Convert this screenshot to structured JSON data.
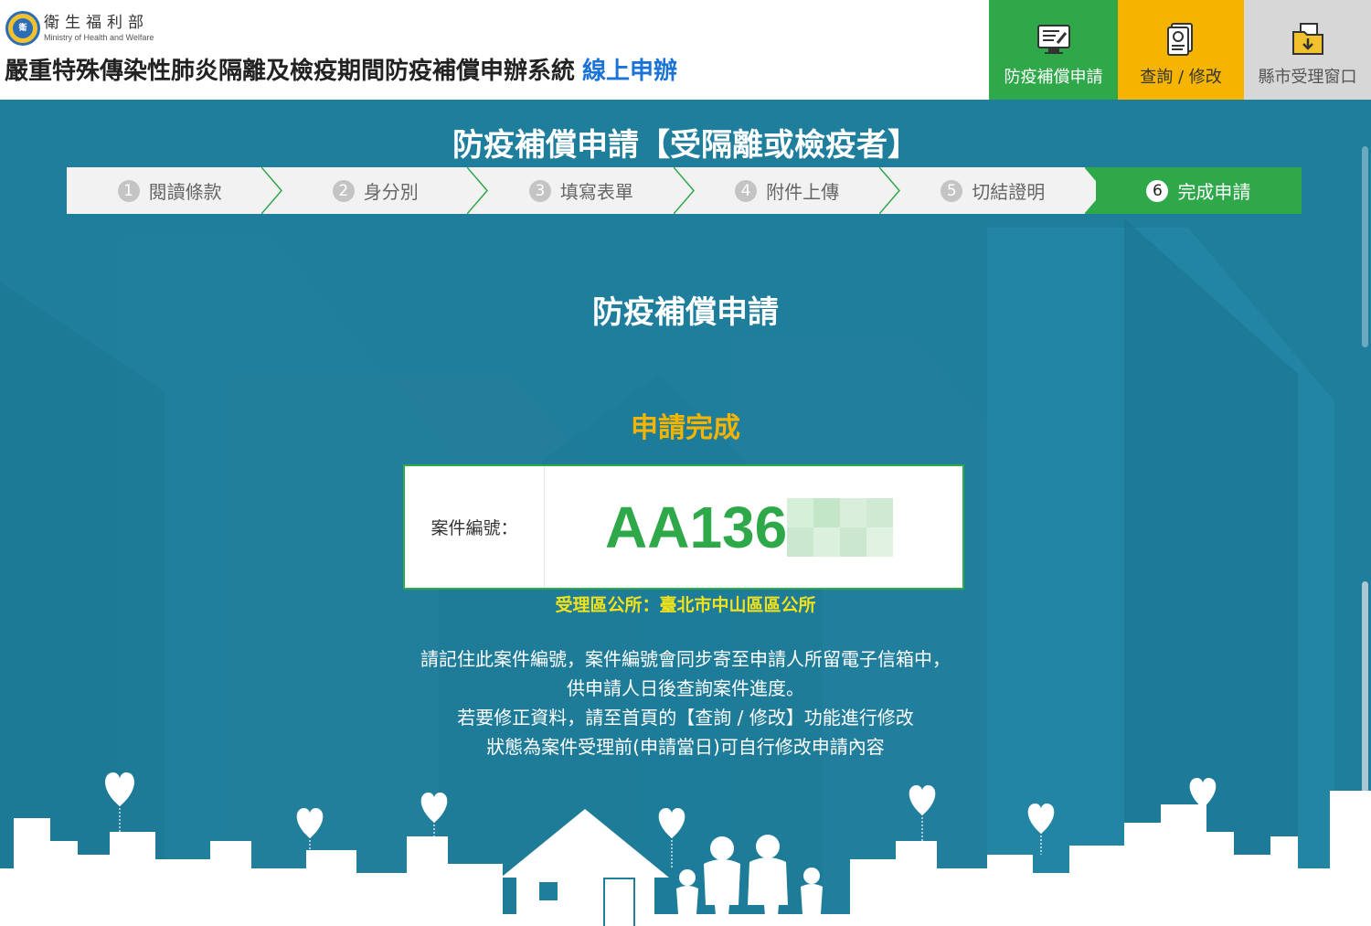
{
  "header": {
    "ministry_zh": "衛生福利部",
    "ministry_en": "Ministry of Health and Welfare",
    "system_title": "嚴重特殊傳染性肺炎隔離及檢疫期間防疫補償申辦系統",
    "online_label": "線上申辦"
  },
  "nav": {
    "apply": "防疫補償申請",
    "query": "查詢 / 修改",
    "window": "縣市受理窗口"
  },
  "colors": {
    "accent_green": "#2fa84a",
    "accent_yellow": "#f5b400",
    "background_teal": "#1e7e9c"
  },
  "page_title": "防疫補償申請【受隔離或檢疫者】",
  "steps": [
    {
      "num": "1",
      "label": "閱讀條款"
    },
    {
      "num": "2",
      "label": "身分別"
    },
    {
      "num": "3",
      "label": "填寫表單"
    },
    {
      "num": "4",
      "label": "附件上傳"
    },
    {
      "num": "5",
      "label": "切結證明"
    },
    {
      "num": "6",
      "label": "完成申請"
    }
  ],
  "active_step": 6,
  "sub_title": "防疫補償申請",
  "status": "申請完成",
  "case": {
    "label": "案件編號：",
    "number_visible": "AA136"
  },
  "office": "受理區公所：臺北市中山區區公所",
  "notes": [
    "請記住此案件編號，案件編號會同步寄至申請人所留電子信箱中，",
    "供申請人日後查詢案件進度。",
    "若要修正資料，請至首頁的【查詢 / 修改】功能進行修改",
    "狀態為案件受理前(申請當日)可自行修改申請內容"
  ]
}
